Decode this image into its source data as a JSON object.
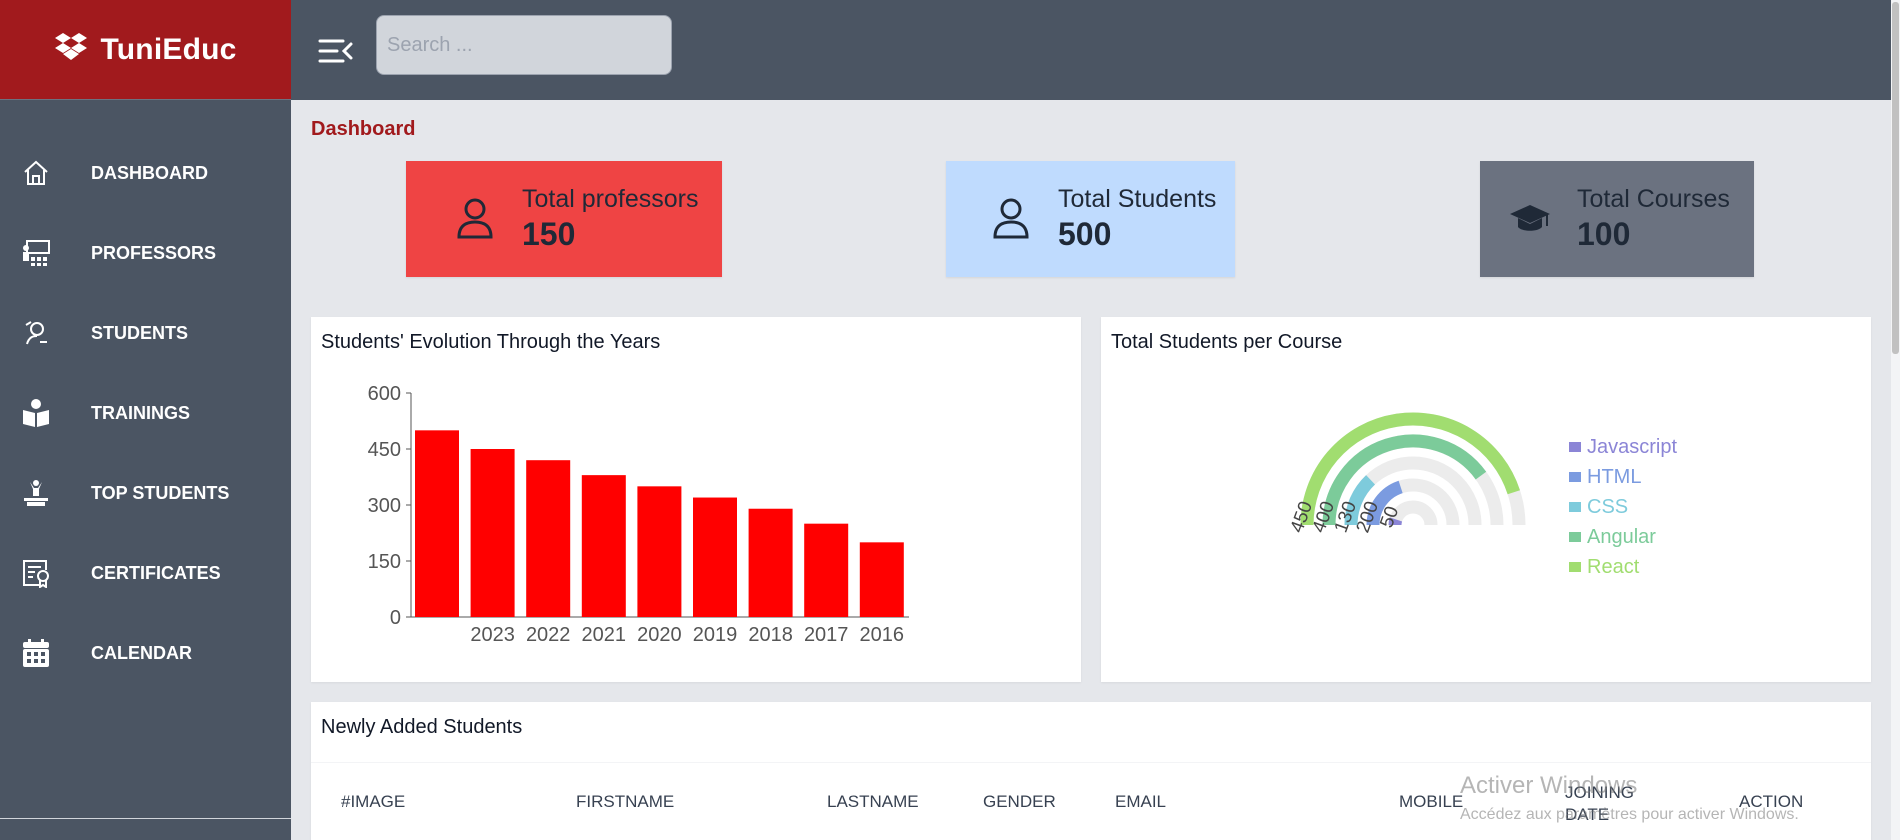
{
  "brand": {
    "name": "TuniEduc"
  },
  "search": {
    "placeholder": "Search ..."
  },
  "sidebar": {
    "items": [
      {
        "label": "DASHBOARD",
        "icon": "home-icon"
      },
      {
        "label": "PROFESSORS",
        "icon": "classroom-icon"
      },
      {
        "label": "STUDENTS",
        "icon": "student-icon"
      },
      {
        "label": "TRAININGS",
        "icon": "reading-icon"
      },
      {
        "label": "TOP STUDENTS",
        "icon": "podium-icon"
      },
      {
        "label": "CERTIFICATES",
        "icon": "certificate-icon"
      },
      {
        "label": "CALENDAR",
        "icon": "calendar-icon"
      }
    ]
  },
  "page": {
    "title": "Dashboard"
  },
  "stats": [
    {
      "label": "Total professors",
      "value": "150",
      "icon": "user-icon",
      "color": "#ef4444"
    },
    {
      "label": "Total Students",
      "value": "500",
      "icon": "user-icon",
      "color": "#bfdbfe"
    },
    {
      "label": "Total Courses",
      "value": "100",
      "icon": "graduation-cap-icon",
      "color": "#6b7280"
    }
  ],
  "chart_data": [
    {
      "type": "bar",
      "title": "Students' Evolution Through the Years",
      "categories": [
        "2023",
        "2022",
        "2021",
        "2020",
        "2019",
        "2018",
        "2017",
        "2016"
      ],
      "values": [
        500,
        450,
        420,
        380,
        350,
        320,
        290,
        250,
        200
      ],
      "yticks": [
        0,
        150,
        300,
        450,
        600
      ],
      "ylim": [
        0,
        600
      ],
      "color": "#ff0000",
      "grid": false
    },
    {
      "type": "radial-bar",
      "title": "Total Students per Course",
      "categories": [
        "Javascript",
        "HTML",
        "CSS",
        "Angular",
        "React"
      ],
      "values": [
        50,
        200,
        130,
        400,
        450
      ],
      "colors": [
        "#8b85d6",
        "#7b9be0",
        "#7ecbdc",
        "#7ccb9a",
        "#a1dd70"
      ],
      "legend": "right"
    }
  ],
  "table": {
    "title": "Newly Added Students",
    "columns": [
      "#IMAGE",
      "FIRSTNAME",
      "LASTNAME",
      "GENDER",
      "EMAIL",
      "MOBILE",
      "JOINING DATE",
      "ACTION"
    ]
  },
  "watermark": {
    "title": "Activer Windows",
    "subtitle": "Accédez aux paramètres pour activer Windows."
  }
}
